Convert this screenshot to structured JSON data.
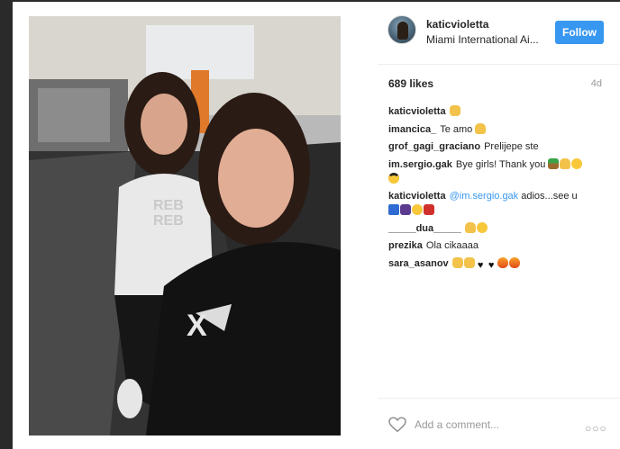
{
  "post": {
    "image_alt": "Two women taking a selfie in Miami International Airport",
    "image_colors": {
      "floor": "#1d1d1d",
      "ceiling": "#c6c6c6",
      "hair": "#2a1b14",
      "hoodie": "#121212",
      "top": "#e9e9e9"
    }
  },
  "header": {
    "username": "katicvioletta",
    "location": "Miami International Ai...",
    "follow_label": "Follow",
    "follow_color": "#3897f0"
  },
  "stats": {
    "likes": "689 likes",
    "age": "4d"
  },
  "comments": [
    {
      "user": "katicvioletta",
      "text": "",
      "emoji": [
        "clap"
      ]
    },
    {
      "user": "imancica_",
      "text": "Te amo",
      "emoji": [
        "ok-hand"
      ]
    },
    {
      "user": "grof_gagi_graciano",
      "text": "Prelijepe ste",
      "emoji": []
    },
    {
      "user": "im.sergio.gak",
      "text": "Bye girls! Thank you",
      "emoji": [
        "palm-tree",
        "ok-hand",
        "hug",
        "cool"
      ]
    },
    {
      "user": "katicvioletta",
      "mention": "@im.sergio.gak",
      "text": " adios...see u",
      "emoji": [
        "abc",
        "woman",
        "smile",
        "dancer"
      ]
    },
    {
      "user": "_____dua_____",
      "text": "",
      "emoji": [
        "ok-hand",
        "smile"
      ]
    },
    {
      "user": "prezika",
      "text": "Ola cikaaaa",
      "emoji": []
    },
    {
      "user": "sara_asanov",
      "text": "",
      "emoji": [
        "clap",
        "clap",
        "black-heart",
        "black-heart",
        "fire",
        "fire"
      ]
    }
  ],
  "footer": {
    "comment_placeholder": "Add a comment...",
    "more_label": "○○○"
  }
}
